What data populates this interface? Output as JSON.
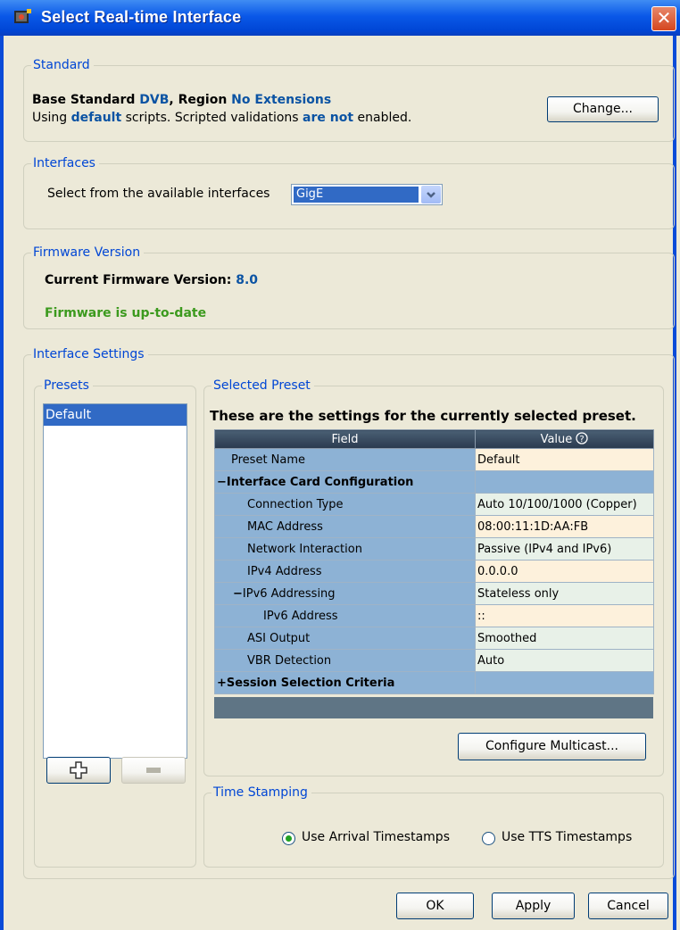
{
  "window": {
    "title": "Select Real-time Interface",
    "close_glyph": "✕"
  },
  "standard": {
    "legend": "Standard",
    "line1": {
      "prefix": "Base Standard ",
      "standard": "DVB",
      "sep": ", Region ",
      "region": "No Extensions"
    },
    "line2": {
      "prefix": "Using ",
      "scripts": "default",
      "mid": " scripts. Scripted validations ",
      "status": "are not",
      "suffix": " enabled."
    },
    "change_button": "Change..."
  },
  "interfaces": {
    "legend": "Interfaces",
    "label": "Select from the available interfaces",
    "selected": "GigE"
  },
  "firmware": {
    "legend": "Firmware Version",
    "current_label": "Current Firmware Version: ",
    "current_value": "8.0",
    "status": "Firmware is up-to-date"
  },
  "interface_settings": {
    "legend": "Interface Settings",
    "presets": {
      "legend": "Presets",
      "items": [
        "Default"
      ]
    },
    "selected_preset": {
      "legend": "Selected Preset",
      "heading": "These are the settings for the currently selected preset.",
      "columns": {
        "field": "Field",
        "value": "Value"
      },
      "rows": [
        {
          "field": "Preset Name",
          "value": "Default"
        },
        {
          "field": "Interface Card Configuration",
          "value": "",
          "toggle": "−"
        },
        {
          "field": "Connection Type",
          "value": "Auto 10/100/1000 (Copper)"
        },
        {
          "field": "MAC Address",
          "value": "08:00:11:1D:AA:FB"
        },
        {
          "field": "Network Interaction",
          "value": "Passive (IPv4 and IPv6)"
        },
        {
          "field": "IPv4 Address",
          "value": "0.0.0.0"
        },
        {
          "field": "IPv6 Addressing",
          "value": "Stateless only",
          "toggle": "−"
        },
        {
          "field": "IPv6 Address",
          "value": "::"
        },
        {
          "field": "ASI Output",
          "value": "Smoothed"
        },
        {
          "field": "VBR Detection",
          "value": "Auto"
        },
        {
          "field": "Session Selection Criteria",
          "value": "",
          "toggle": "+"
        }
      ],
      "configure_multicast_button": "Configure Multicast..."
    },
    "time_stamping": {
      "legend": "Time Stamping",
      "option_arrival": "Use Arrival Timestamps",
      "option_tts": "Use TTS Timestamps",
      "selected": "arrival"
    }
  },
  "buttons": {
    "ok": "OK",
    "apply": "Apply",
    "cancel": "Cancel"
  }
}
